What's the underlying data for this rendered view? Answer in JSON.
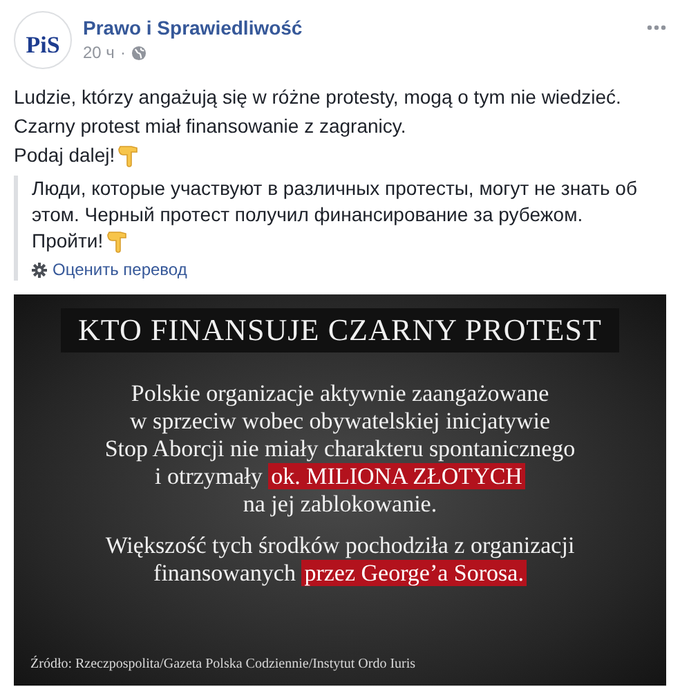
{
  "post": {
    "author": "Prawo i Sprawiedliwość",
    "avatar_text": "PiS",
    "time": "20 ч",
    "separator": "·",
    "text_lines": [
      {
        "text": "Ludzie, którzy angażują się w różne protesty, mogą o tym nie wiedzieć.",
        "pointing_emoji": false
      },
      {
        "text": "Czarny protest miał finansowanie z zagranicy.",
        "pointing_emoji": false
      },
      {
        "text": "Podaj dalej!",
        "pointing_emoji": true
      }
    ],
    "translation": {
      "lines": [
        {
          "text": "Люди, которые участвуют в различных протесты, могут не знать об",
          "pointing_emoji": false
        },
        {
          "text": "этом. Черный протест получил финансирование за рубежом.",
          "pointing_emoji": false
        },
        {
          "text": "Пройти!",
          "pointing_emoji": true
        }
      ],
      "rate_link": "Оценить перевод"
    },
    "graphic": {
      "title": "KTO FINANSUJE CZARNY PROTEST",
      "paragraphs": [
        [
          [
            {
              "text": "Polskie organizacje aktywnie zaangażowane",
              "highlight": false
            }
          ],
          [
            {
              "text": "w sprzeciw wobec obywatelskiej inicjatywie",
              "highlight": false
            }
          ],
          [
            {
              "text": "Stop Aborcji nie miały charakteru spontanicznego",
              "highlight": false
            }
          ],
          [
            {
              "text": "i otrzymały ",
              "highlight": false
            },
            {
              "text": "ok. MILIONA ZŁOTYCH",
              "highlight": true
            }
          ],
          [
            {
              "text": "na jej zablokowanie.",
              "highlight": false
            }
          ]
        ],
        [
          [
            {
              "text": "Większość tych środków pochodziła z organizacji",
              "highlight": false
            }
          ],
          [
            {
              "text": "finansowanych ",
              "highlight": false
            },
            {
              "text": "przez George’a Sorosa.",
              "highlight": true
            }
          ]
        ]
      ],
      "source": "Źródło: Rzeczpospolita/Gazeta Polska Codziennie/Instytut Ordo Iuris"
    }
  }
}
